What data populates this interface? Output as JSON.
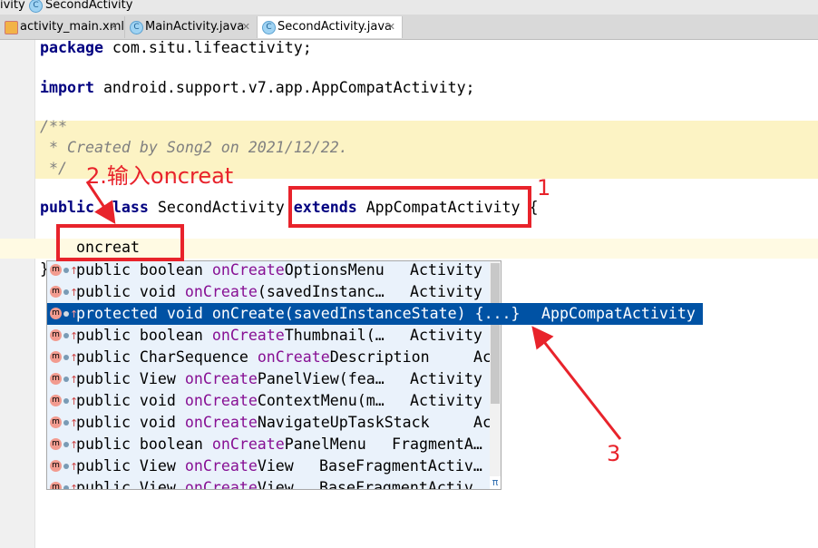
{
  "breadcrumb": [
    "ivity",
    "SecondActivity"
  ],
  "tabs": [
    {
      "label": "activity_main.xml"
    },
    {
      "label": "MainActivity.java"
    },
    {
      "label": "SecondActivity.java",
      "active": true
    }
  ],
  "code": {
    "package_kw": "package",
    "package_name": " com.situ.lifeactivity;",
    "import_kw": "import",
    "import_name": " android.support.v7.app.AppCompatActivity;",
    "comment1": "/**",
    "comment2": " * Created by Song2 on 2021/12/22.",
    "comment3": " */",
    "public_kw": "public",
    "class_kw": " class",
    "class_name": " SecondActivity ",
    "extends_kw": "extends",
    "parent": " AppCompatActivity {",
    "typed": "oncreat",
    "close_brace": "}"
  },
  "completion": {
    "items": [
      {
        "pre": "public boolean ",
        "match": "onCreate",
        "post": "OptionsMenu",
        "type": "Activity"
      },
      {
        "pre": "public void ",
        "match": "onCreate",
        "post": "(savedInstanc…",
        "type": "Activity"
      },
      {
        "pre": "protected void onCreate(savedInstanceState) {...}",
        "match": "",
        "post": "",
        "type": "AppCompatActivity",
        "selected": true
      },
      {
        "pre": "public boolean ",
        "match": "onCreate",
        "post": "Thumbnail(…",
        "type": "Activity"
      },
      {
        "pre": "public CharSequence ",
        "match": "onCreate",
        "post": "Description",
        "type": "Ac…"
      },
      {
        "pre": "public View ",
        "match": "onCreate",
        "post": "PanelView(fea…",
        "type": "Activity"
      },
      {
        "pre": "public void ",
        "match": "onCreate",
        "post": "ContextMenu(m…",
        "type": "Activity"
      },
      {
        "pre": "public void ",
        "match": "onCreate",
        "post": "NavigateUpTaskStack",
        "type": "Ac…"
      },
      {
        "pre": "public boolean ",
        "match": "onCreate",
        "post": "PanelMenu",
        "type": "FragmentA…"
      },
      {
        "pre": "public View ",
        "match": "onCreate",
        "post": "View",
        "type": "BaseFragmentActiv…"
      },
      {
        "pre": "public View ",
        "match": "onCreate",
        "post": "View",
        "type": "BaseFragmentActiv…"
      }
    ],
    "pi": "π"
  },
  "annotations": {
    "label1": "1",
    "label2": "2.输入oncreat",
    "label3": "3",
    "color": "#e8232b"
  }
}
